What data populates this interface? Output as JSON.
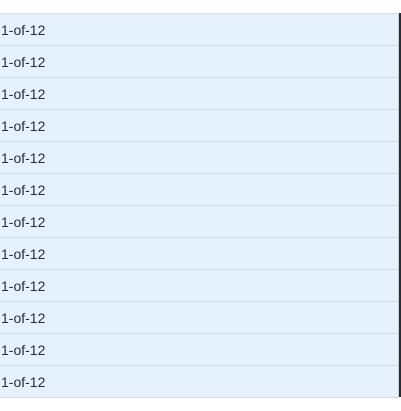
{
  "grid": {
    "rows": [
      {
        "label": "1-of-12"
      },
      {
        "label": "1-of-12"
      },
      {
        "label": "1-of-12"
      },
      {
        "label": "1-of-12"
      },
      {
        "label": "1-of-12"
      },
      {
        "label": "1-of-12"
      },
      {
        "label": "1-of-12"
      },
      {
        "label": "1-of-12"
      },
      {
        "label": "1-of-12"
      },
      {
        "label": "1-of-12"
      },
      {
        "label": "1-of-12"
      },
      {
        "label": "1-of-12"
      }
    ]
  },
  "colors": {
    "row_background": "#e5f1fd",
    "row_border": "#d0dae6",
    "text": "#1f2d3d"
  }
}
